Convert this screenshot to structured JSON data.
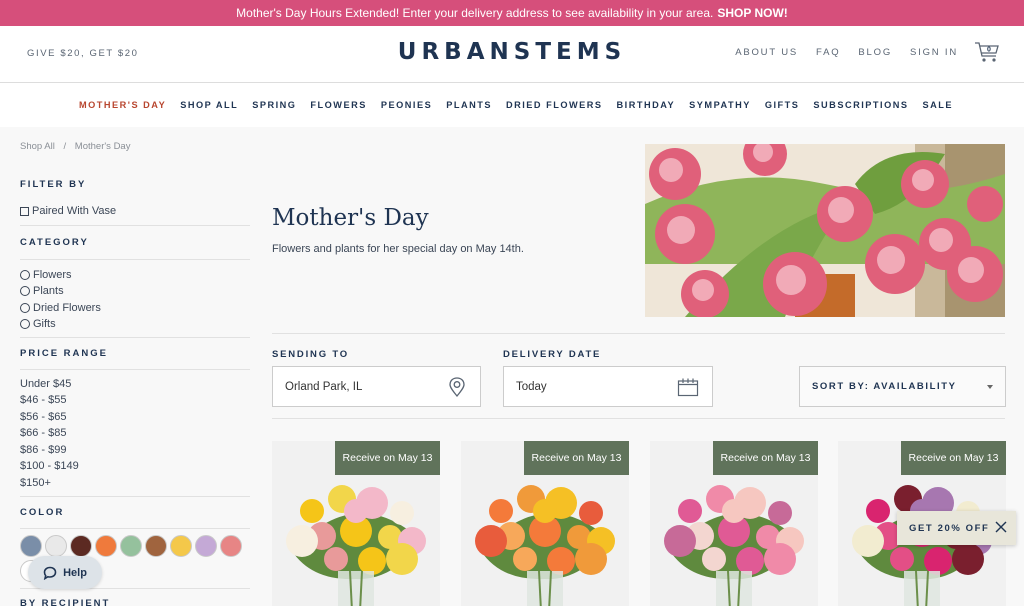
{
  "promo_bar": {
    "text": "Mother's Day Hours Extended! Enter your delivery address to see availability in your area.",
    "cta": "SHOP NOW!",
    "color": "#d64f7b"
  },
  "header": {
    "referral": "GIVE $20, GET $20",
    "logo": "URBANSTEMS",
    "links": [
      "ABOUT US",
      "FAQ",
      "BLOG",
      "SIGN IN"
    ],
    "cart_count": "0",
    "cart_icon": "cart-icon"
  },
  "nav": {
    "items": [
      "MOTHER'S DAY",
      "SHOP ALL",
      "SPRING",
      "FLOWERS",
      "PEONIES",
      "PLANTS",
      "DRIED FLOWERS",
      "BIRTHDAY",
      "SYMPATHY",
      "GIFTS",
      "SUBSCRIPTIONS",
      "SALE"
    ],
    "active": "MOTHER'S DAY",
    "active_color": "#b8462f"
  },
  "breadcrumb": {
    "items": [
      "Shop All",
      "/",
      "Mother's Day"
    ]
  },
  "sidebar": {
    "filter_by": "FILTER BY",
    "vase_option": "Paired With Vase",
    "category_heading": "CATEGORY",
    "categories": [
      "Flowers",
      "Plants",
      "Dried Flowers",
      "Gifts"
    ],
    "price_heading": "PRICE RANGE",
    "prices": [
      "Under $45",
      "$46 - $55",
      "$56 - $65",
      "$66 - $85",
      "$86 - $99",
      "$100 - $149",
      "$150+"
    ],
    "color_heading": "COLOR",
    "colors": [
      "#7a8ea8",
      "#e9e9e9",
      "#5c2a22",
      "#ef7a3c",
      "#95c19d",
      "#a0643e",
      "#f4c84a",
      "#c4a9d6",
      "#e78585",
      "#ffffff",
      "#ecc89a",
      "#8aa24a"
    ],
    "recipient_heading": "BY RECIPIENT"
  },
  "help_button": {
    "label": "Help",
    "icon": "chat-bubble-icon"
  },
  "hero": {
    "title": "Mother's Day",
    "subtitle": "Flowers and plants for her special day on May 14th."
  },
  "delivery": {
    "sending_label": "SENDING TO",
    "sending_value": "Orland Park, IL",
    "sending_icon": "location-pin-icon",
    "date_label": "DELIVERY DATE",
    "date_value": "Today",
    "date_icon": "calendar-icon",
    "sort_label": "SORT BY: AVAILABILITY"
  },
  "products": [
    {
      "badge": "Receive on May 13",
      "palette": [
        "#f5c518",
        "#f2d64a",
        "#f3b8c9",
        "#f7efe0",
        "#e89a9a"
      ]
    },
    {
      "badge": "Receive on May 13",
      "palette": [
        "#f47a3a",
        "#f09a3a",
        "#f5c025",
        "#e85c3c",
        "#f7a85a"
      ]
    },
    {
      "badge": "Receive on May 13",
      "palette": [
        "#e05a95",
        "#f08aa8",
        "#f6c7c0",
        "#c76a98",
        "#f3d6d0"
      ]
    },
    {
      "badge": "Receive on May 13",
      "palette": [
        "#d9246f",
        "#7a1f2e",
        "#a777b0",
        "#f2ecd0",
        "#e34f86"
      ]
    }
  ],
  "popup": {
    "label": "GET 20% OFF",
    "close_icon": "close-icon"
  }
}
